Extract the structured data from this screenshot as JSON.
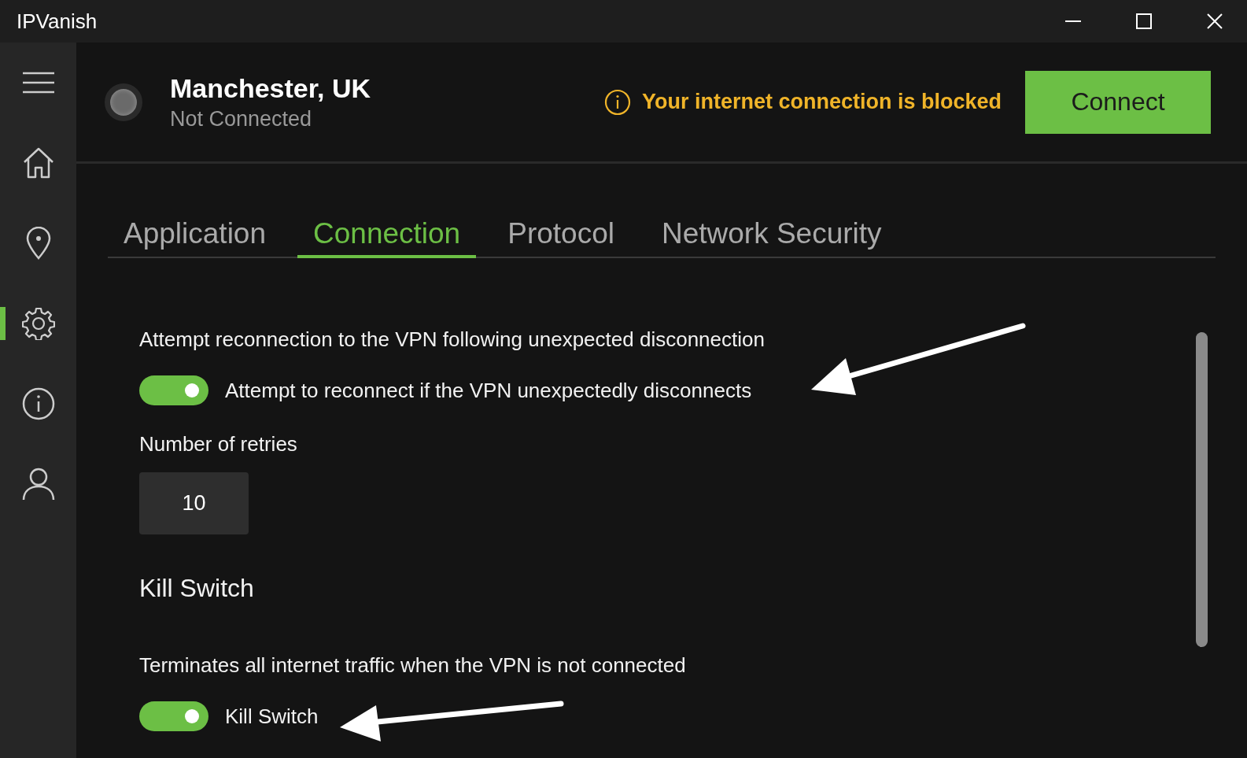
{
  "window": {
    "title": "IPVanish"
  },
  "sidebar": {
    "items": [
      {
        "kind": "menu",
        "selected": false
      },
      {
        "kind": "home",
        "selected": false
      },
      {
        "kind": "location",
        "selected": false
      },
      {
        "kind": "settings",
        "selected": true
      },
      {
        "kind": "info",
        "selected": false
      },
      {
        "kind": "account",
        "selected": false
      }
    ]
  },
  "status": {
    "location": "Manchester, UK",
    "state": "Not Connected",
    "connected": false
  },
  "alert": {
    "text": "Your internet connection is blocked"
  },
  "connect_button": {
    "label": "Connect"
  },
  "tabs": [
    {
      "label": "Application",
      "selected": false
    },
    {
      "label": "Connection",
      "selected": true
    },
    {
      "label": "Protocol",
      "selected": false
    },
    {
      "label": "Network Security",
      "selected": false
    }
  ],
  "settings": [
    {
      "kind": "description",
      "text": "Attempt reconnection to the VPN following unexpected disconnection"
    },
    {
      "kind": "toggle",
      "label": "Attempt to reconnect if the VPN unexpectedly disconnects",
      "on": true
    },
    {
      "kind": "label",
      "text": "Number of retries"
    },
    {
      "kind": "number",
      "value": "10"
    },
    {
      "kind": "heading",
      "text": "Kill Switch"
    },
    {
      "kind": "description",
      "text": "Terminates all internet traffic when the VPN is not connected"
    },
    {
      "kind": "toggle",
      "label": "Kill Switch",
      "on": true
    }
  ]
}
